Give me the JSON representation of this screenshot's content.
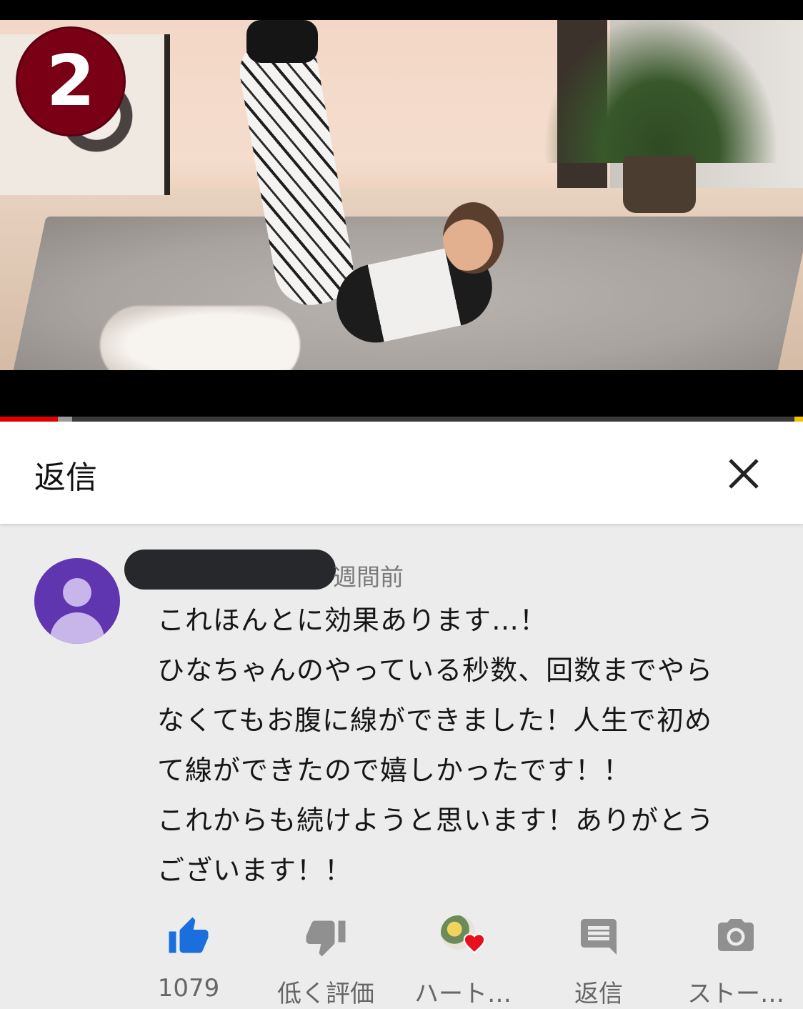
{
  "video": {
    "badge_number": "2",
    "progress": {
      "played_fraction": 0.072
    }
  },
  "header": {
    "title": "返信"
  },
  "comment": {
    "time": "週間前",
    "lines": [
      "これほんとに効果あります…！",
      "ひなちゃんのやっている秒数、回数までやら",
      "なくてもお腹に線ができました！人生で初め",
      "て線ができたので嬉しかったです！！",
      "これからも続けようと思います！ありがとう",
      "ございます！！"
    ],
    "actions": {
      "like_count": "1079",
      "dislike_label": "低く評価",
      "heart_label": "ハート…",
      "reply_label": "返信",
      "story_label": "ストー…"
    }
  },
  "colors": {
    "like_blue": "#1a6fdc",
    "icon_gray": "#909090",
    "progress_red": "#e00000",
    "avatar_purple": "#5f35b0",
    "heart_red": "#e8101c"
  }
}
